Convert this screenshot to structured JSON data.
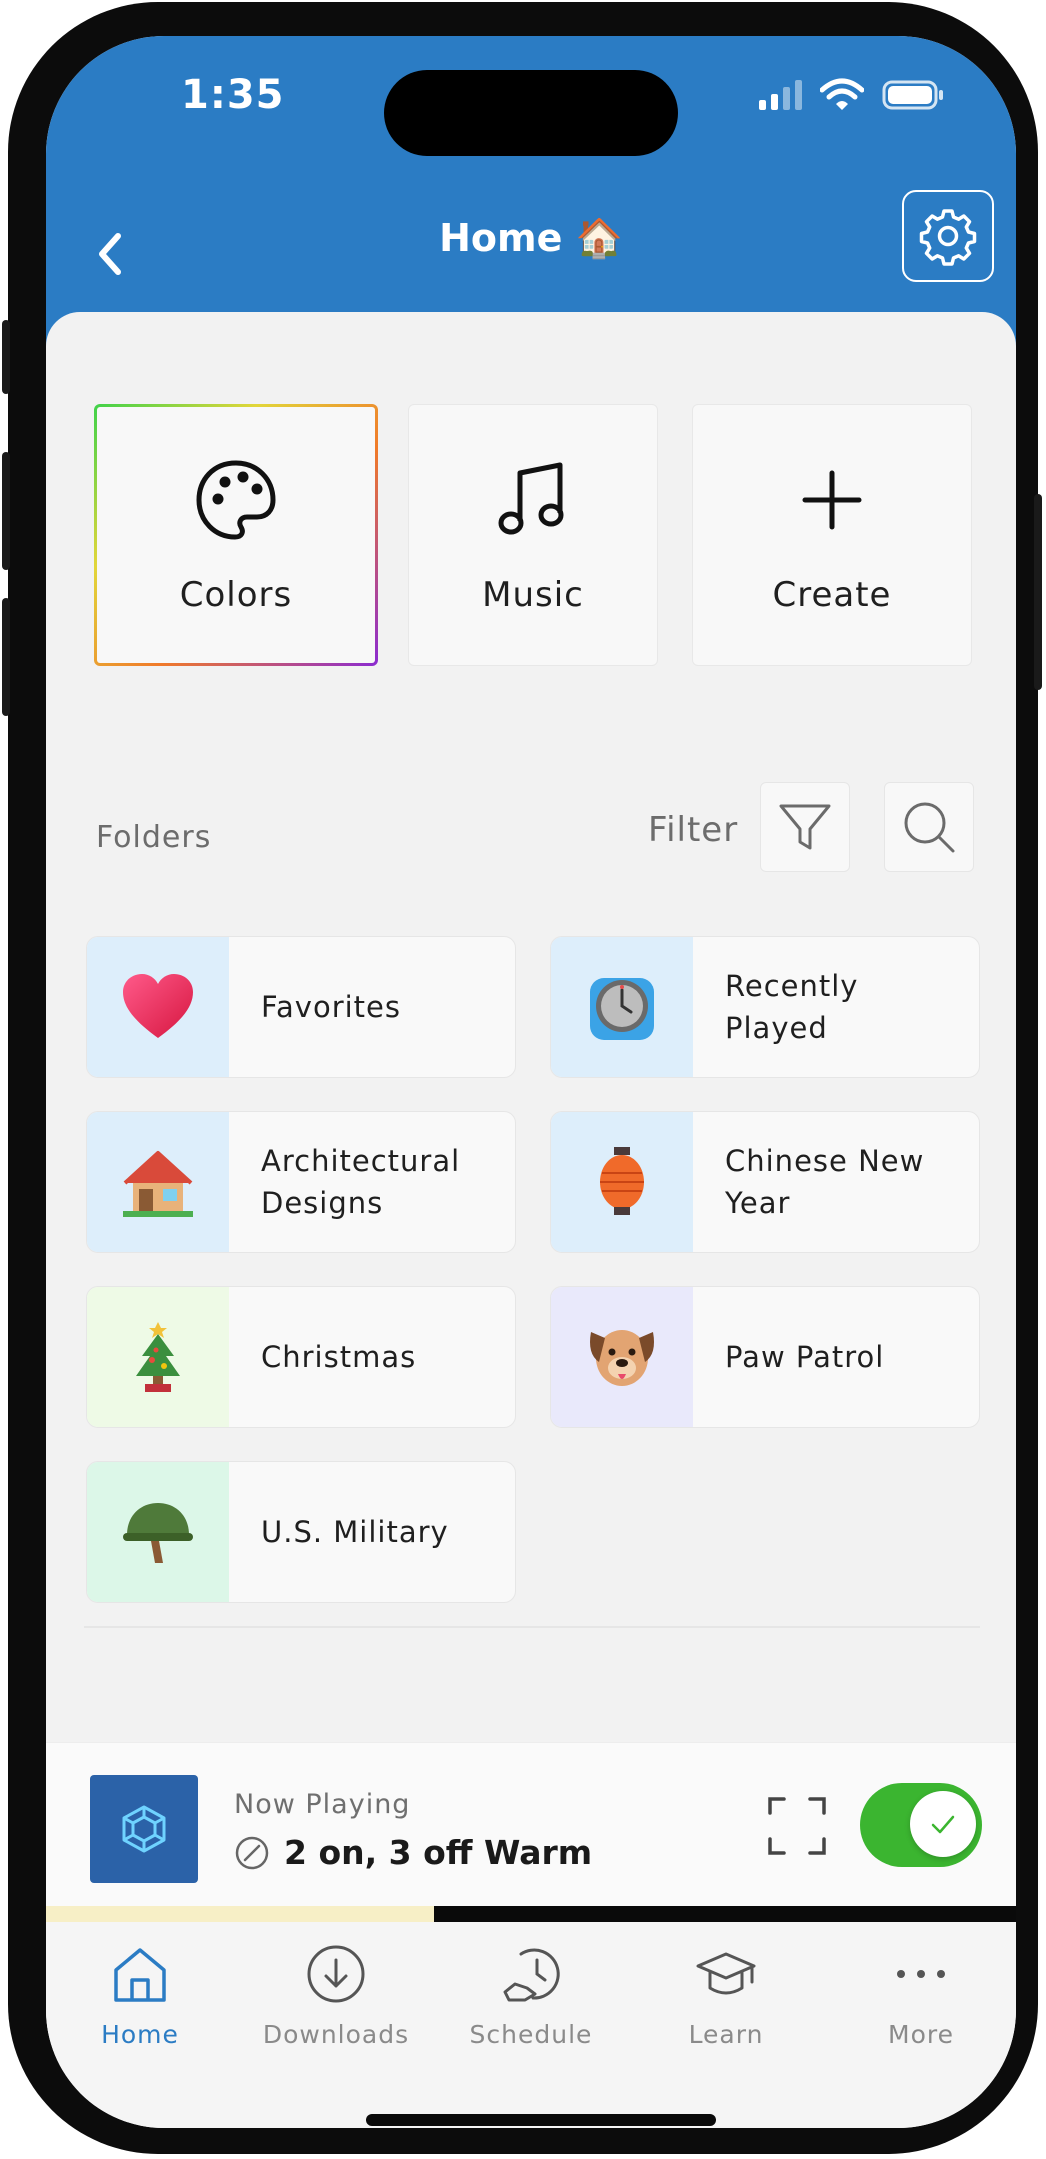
{
  "status_bar": {
    "time": "1:35"
  },
  "header": {
    "title": "Home",
    "title_emoji": "🏠",
    "back_icon": "chevron-left-icon",
    "settings_icon": "gear-icon"
  },
  "modes": [
    {
      "label": "Colors",
      "icon": "palette-icon",
      "selected": true
    },
    {
      "label": "Music",
      "icon": "music-note-icon",
      "selected": false
    },
    {
      "label": "Create",
      "icon": "plus-icon",
      "selected": false
    }
  ],
  "folders_section": {
    "label": "Folders",
    "filter_label": "Filter"
  },
  "folders": [
    {
      "label": "Favorites",
      "emoji": "❤️",
      "bg": "#ddeefb"
    },
    {
      "label": "Recently Played",
      "emoji": "🕰️",
      "bg": "#ddeefb"
    },
    {
      "label": "Architectural Designs",
      "emoji": "🏠",
      "bg": "#ddeefb"
    },
    {
      "label": "Chinese New Year",
      "emoji": "🏮",
      "bg": "#ddeefb"
    },
    {
      "label": "Christmas",
      "emoji": "🎄",
      "bg": "#eefae6"
    },
    {
      "label": "Paw Patrol",
      "emoji": "🐶",
      "bg": "#e9e9fb"
    },
    {
      "label": "U.S. Military",
      "emoji": "🪖",
      "bg": "#dcf7e8"
    }
  ],
  "now_playing": {
    "label": "Now Playing",
    "title": "2 on, 3 off Warm",
    "toggle_on": true,
    "progress": 0.4
  },
  "nav": [
    {
      "label": "Home",
      "icon": "home-icon",
      "active": true
    },
    {
      "label": "Downloads",
      "icon": "download-icon",
      "active": false
    },
    {
      "label": "Schedule",
      "icon": "schedule-icon",
      "active": false
    },
    {
      "label": "Learn",
      "icon": "graduation-cap-icon",
      "active": false
    },
    {
      "label": "More",
      "icon": "more-dots-icon",
      "active": false
    }
  ],
  "colors": {
    "brand_blue": "#2b7cc4",
    "toggle_green": "#3bb530"
  }
}
